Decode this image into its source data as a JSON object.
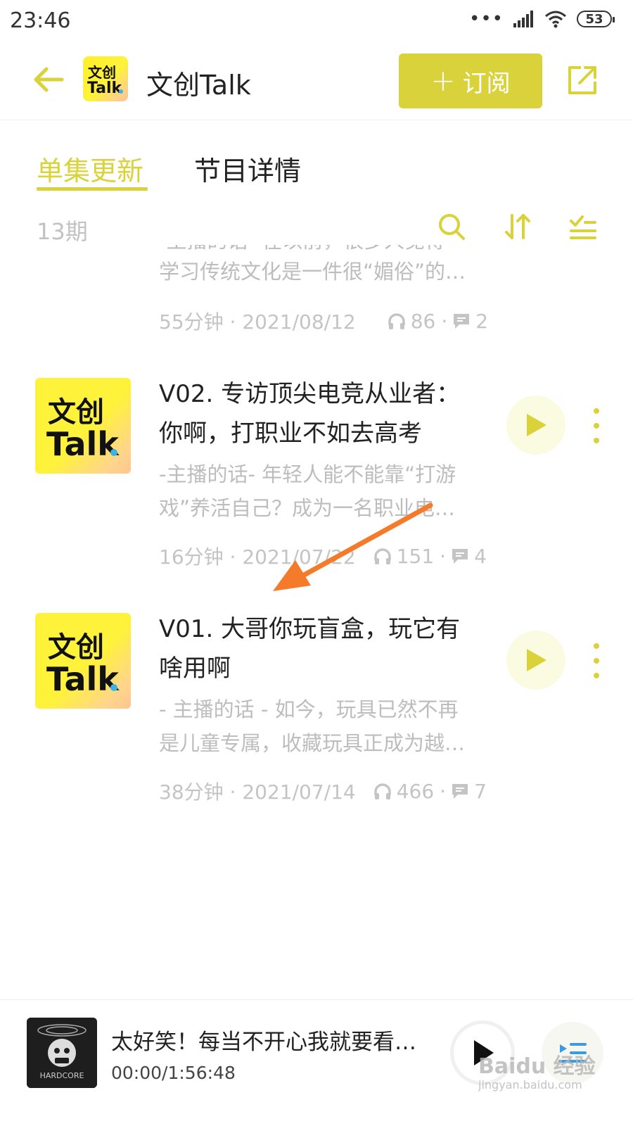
{
  "status_bar": {
    "time": "23:46",
    "signal_dots": "•••",
    "battery": "53"
  },
  "header": {
    "title": "文创Talk",
    "subscribe_label": "订阅",
    "subscribe_icon": "plus-icon",
    "back_icon": "arrow-left-icon",
    "share_icon": "share-icon",
    "logo_text": "文创Talk"
  },
  "tabs": [
    {
      "label": "单集更新",
      "active": true
    },
    {
      "label": "节目详情",
      "active": false
    }
  ],
  "list_header": {
    "count": "13期",
    "tools": [
      "search-icon",
      "sort-icon",
      "filter-list-icon"
    ]
  },
  "episodes": [
    {
      "title": "",
      "desc_line_1": "-主播的话- 在以前，很多人觉得",
      "desc_line_2": "学习传统文化是一件很“媚俗”的…",
      "duration_date": "55分钟 · 2021/08/12",
      "plays": "86",
      "comments": "2"
    },
    {
      "title_line_1": "V02. 专访顶尖电竞从业者：",
      "title_line_2": "你啊，打职业不如去高考",
      "desc_line_1": "-主播的话- 年轻人能不能靠“打游",
      "desc_line_2": "戏”养活自己？成为一名职业电…",
      "duration_date": "16分钟 · 2021/07/22",
      "plays": "151",
      "comments": "4",
      "cover_text": "文创Talk"
    },
    {
      "title_line_1": "V01. 大哥你玩盲盒，玩它有",
      "title_line_2": "啥用啊",
      "desc_line_1": "- 主播的话 - 如今，玩具已然不再",
      "desc_line_2": "是儿童专属，收藏玩具正成为越…",
      "duration_date": "38分钟 · 2021/07/14",
      "plays": "466",
      "comments": "7",
      "cover_text": "文创Talk"
    }
  ],
  "player": {
    "title": "太好笑！每当不开心我就要看…",
    "time": "00:00/1:56:48",
    "cover_text": "HARDCORE"
  },
  "watermark": {
    "brand": "Baidu 经验",
    "url": "jingyan.baidu.com"
  },
  "colors": {
    "accent": "#d9d23a",
    "cover_yellow": "#fff23a",
    "annotation": "#f57a2a"
  }
}
